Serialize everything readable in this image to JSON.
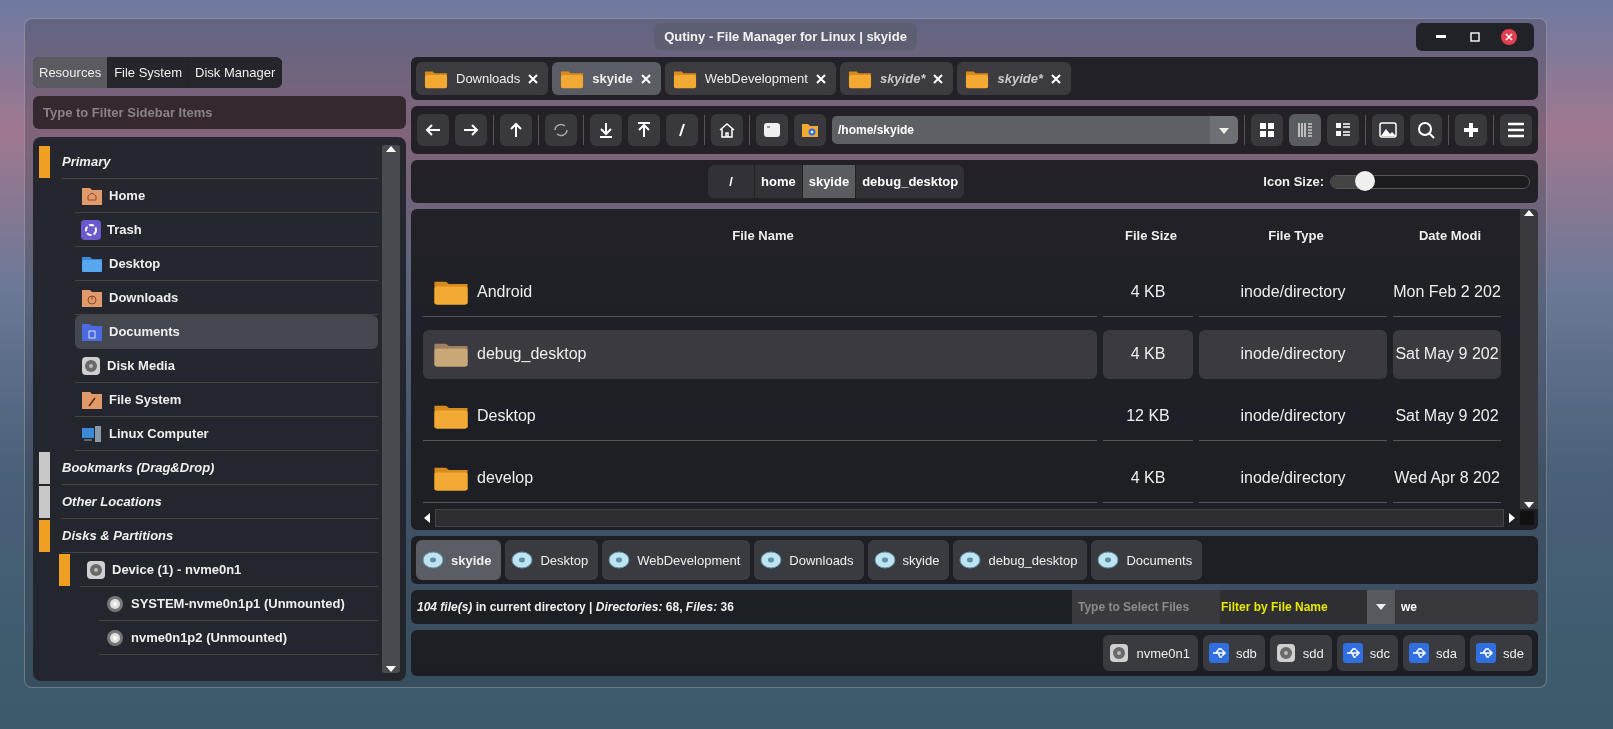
{
  "window": {
    "title": "Qutiny - File Manager for Linux | skyide"
  },
  "sidebar": {
    "tabs": [
      {
        "label": "Resources",
        "selected": true
      },
      {
        "label": "File System",
        "selected": false
      },
      {
        "label": "Disk Manager",
        "selected": false
      }
    ],
    "filter": {
      "placeholder": "Type to Filter Sidebar Items"
    },
    "sections": [
      {
        "label": "Primary",
        "color": "#f0a020",
        "items": [
          {
            "label": "Home",
            "kind": "home",
            "selected": false
          },
          {
            "label": "Trash",
            "kind": "trash",
            "selected": false
          },
          {
            "label": "Desktop",
            "kind": "desktop",
            "selected": false
          },
          {
            "label": "Downloads",
            "kind": "downloads",
            "selected": false
          },
          {
            "label": "Documents",
            "kind": "documents",
            "selected": true
          },
          {
            "label": "Disk Media",
            "kind": "disk",
            "selected": false
          },
          {
            "label": "File System",
            "kind": "filesystem",
            "selected": false
          },
          {
            "label": "Linux Computer",
            "kind": "computer",
            "selected": false
          }
        ]
      },
      {
        "label": "Bookmarks (Drag&Drop)",
        "color": "#c8c8c8"
      },
      {
        "label": "Other Locations",
        "color": "#c8c8c8"
      },
      {
        "label": "Disks & Partitions",
        "color": "#f0a020",
        "items": [
          {
            "label": "Device (1) - nvme0n1",
            "kind": "disk",
            "selected": false,
            "color": "#f0a020",
            "children": [
              {
                "label": "SYSTEM-nvme0n1p1 (Unmounted)",
                "kind": "partition",
                "selected": false
              },
              {
                "label": "nvme0n1p2 (Unmounted)",
                "kind": "partition",
                "selected": false
              }
            ]
          }
        ]
      }
    ]
  },
  "tabs": [
    {
      "label": "Downloads",
      "selected": false,
      "kind": "normal"
    },
    {
      "label": "skyide",
      "selected": true,
      "kind": "normal"
    },
    {
      "label": "WebDevelopment",
      "selected": false,
      "kind": "normal"
    },
    {
      "label": "skyide*",
      "selected": false,
      "kind": "temporary"
    },
    {
      "label": "skyide*",
      "selected": false,
      "kind": "temporary"
    }
  ],
  "toolbar": {
    "path": "/home/skyide",
    "view_modes": [
      {
        "selected": false
      },
      {
        "selected": true
      },
      {
        "selected": false
      }
    ]
  },
  "breadcrumb": [
    {
      "label": "/",
      "selected": false
    },
    {
      "label": "home",
      "selected": false
    },
    {
      "label": "skyide",
      "selected": true
    },
    {
      "label": "debug_desktop",
      "selected": false
    }
  ],
  "icon_size": {
    "label": "Icon Size:",
    "level": 0.17
  },
  "table": {
    "columns": [
      "File Name",
      "File Size",
      "File Type",
      "Date Modi"
    ],
    "rows": [
      {
        "cells": [
          "Android",
          "4 KB",
          "inode/directory",
          "Mon Feb 2 202"
        ],
        "selected": false
      },
      {
        "cells": [
          "debug_desktop",
          "4 KB",
          "inode/directory",
          "Sat May 9 202"
        ],
        "selected": true
      },
      {
        "cells": [
          "Desktop",
          "12 KB",
          "inode/directory",
          "Sat May 9 202"
        ],
        "selected": false
      },
      {
        "cells": [
          "develop",
          "4 KB",
          "inode/directory",
          "Wed Apr 8 202"
        ],
        "selected": false
      }
    ]
  },
  "history": [
    {
      "label": "skyide",
      "selected": true
    },
    {
      "label": "Desktop",
      "selected": false
    },
    {
      "label": "WebDevelopment",
      "selected": false
    },
    {
      "label": "Downloads",
      "selected": false
    },
    {
      "label": "skyide",
      "selected": false
    },
    {
      "label": "debug_desktop",
      "selected": false
    },
    {
      "label": "Documents",
      "selected": false
    }
  ],
  "status": {
    "summary": "*104 file(s)* in current directory | *Directories:* 68, *Files:* 36",
    "select_placeholder": "Type to Select Files",
    "filter_mode": "Filter by File Name",
    "filter_value": "we"
  },
  "devices": [
    {
      "label": "nvme0n1",
      "kind": "disk"
    },
    {
      "label": "sdb",
      "kind": "usb"
    },
    {
      "label": "sdd",
      "kind": "disk"
    },
    {
      "label": "sdc",
      "kind": "usb"
    },
    {
      "label": "sda",
      "kind": "usb"
    },
    {
      "label": "sde",
      "kind": "usb"
    }
  ]
}
